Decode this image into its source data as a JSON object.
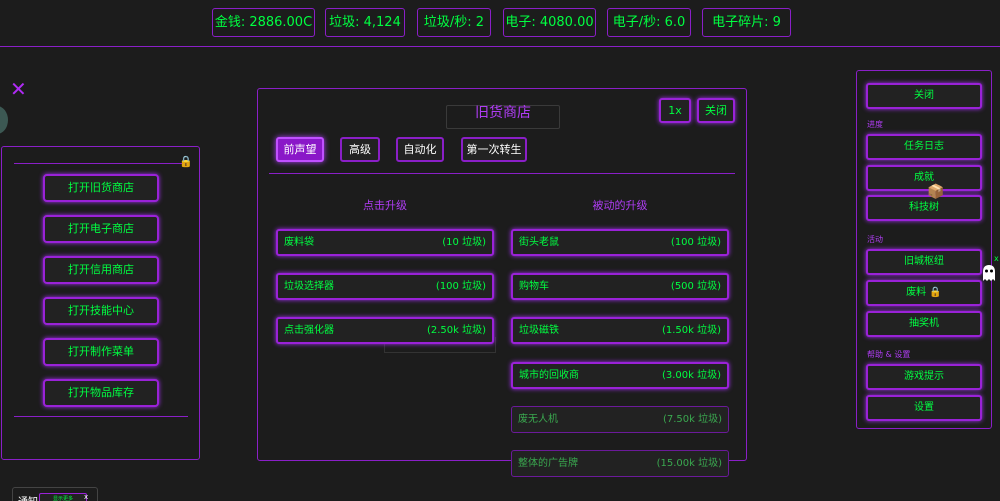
{
  "stats": [
    {
      "id": "money",
      "text": "金钱: 2886.00C"
    },
    {
      "id": "scrap",
      "text": "垃圾: 4,124"
    },
    {
      "id": "scrap-per-sec",
      "text": "垃圾/秒: 2"
    },
    {
      "id": "electrons",
      "text": "电子: 4080.00"
    },
    {
      "id": "electrons-per-sec",
      "text": "电子/秒: 6.0"
    },
    {
      "id": "electron-fragments",
      "text": "电子碎片:   9"
    }
  ],
  "close_symbol": "✕",
  "left_panel": {
    "lock_icon": "🔒",
    "buttons": [
      "打开旧货商店",
      "打开电子商店",
      "打开信用商店",
      "打开技能中心",
      "打开制作菜单",
      "打开物品库存"
    ]
  },
  "shop": {
    "title": "旧货商店",
    "multiplier_label": "1x",
    "close_label": "关闭",
    "tabs": [
      "前声望",
      "高级",
      "自动化",
      "第一次转生"
    ],
    "active_tab": 0,
    "click_header": "点击升级",
    "passive_header": "被动的升级",
    "click_upgrades": [
      {
        "name": "废料袋",
        "cost": "(10 垃圾)"
      },
      {
        "name": "垃圾选择器",
        "cost": "(100 垃圾)"
      },
      {
        "name": "点击强化器",
        "cost": "(2.50k 垃圾)"
      }
    ],
    "passive_upgrades": [
      {
        "name": "街头老鼠",
        "cost": "(100 垃圾)",
        "affordable": true
      },
      {
        "name": "购物车",
        "cost": "(500 垃圾)",
        "affordable": true
      },
      {
        "name": "垃圾磁铁",
        "cost": "(1.50k 垃圾)",
        "affordable": true
      },
      {
        "name": "城市的回收商",
        "cost": "(3.00k 垃圾)",
        "affordable": true
      },
      {
        "name": "废无人机",
        "cost": "(7.50k 垃圾)",
        "affordable": false
      },
      {
        "name": "整体的广告牌",
        "cost": "(15.00k 垃圾)",
        "affordable": false
      }
    ]
  },
  "right_panel": {
    "close_label": "关闭",
    "progress_label": "进度",
    "quest_log": "任务日志",
    "achievements": "成就",
    "tech_tree": "科技树",
    "activities_label": "活动",
    "old_city_hub": "旧城枢纽",
    "scrap_locked": "废料 🔒",
    "lottery": "抽奖机",
    "help_label": "帮助 & 设置",
    "game_tips": "游戏提示",
    "settings": "设置"
  },
  "ghost_close": "x",
  "notification": {
    "label": "通知",
    "button": "显示更多",
    "close": "x"
  },
  "colors": {
    "background": "#1c1c1c",
    "text_green": "#00ff41",
    "purple_border": "#8a1fc7",
    "purple_title": "#b03df5",
    "active_tab": "#8a18c8"
  }
}
